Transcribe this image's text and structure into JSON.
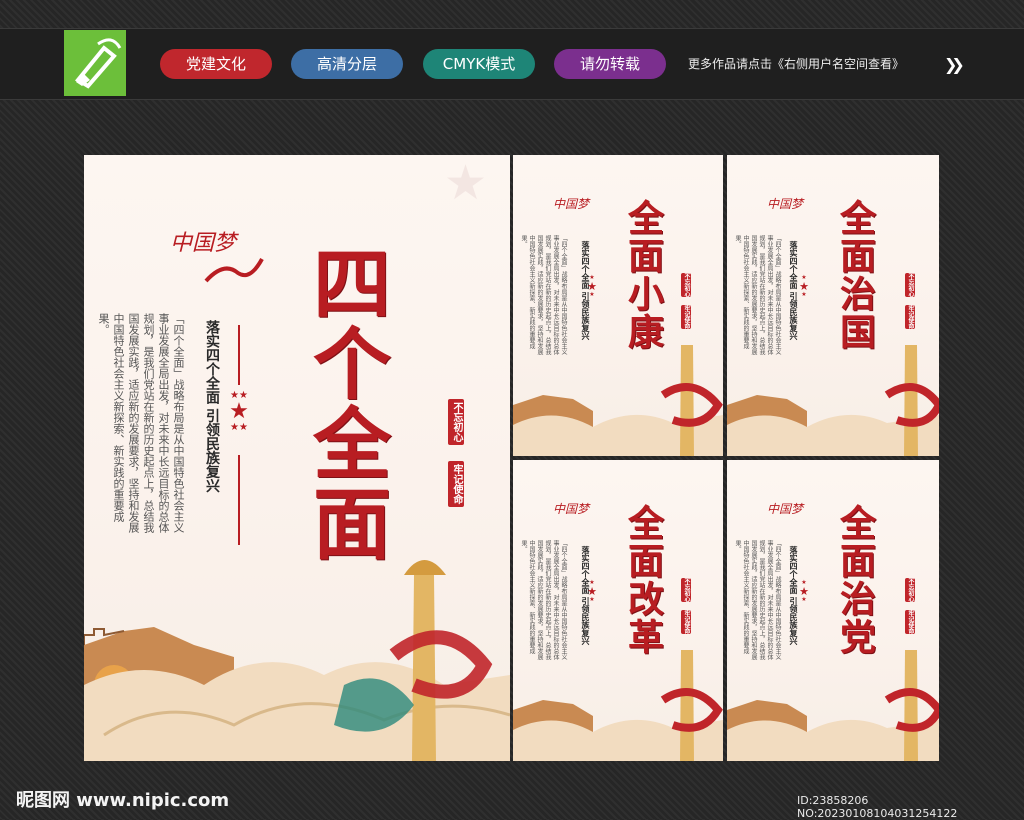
{
  "toolbar": {
    "tags": [
      {
        "label": "党建文化",
        "color": "#c0272d"
      },
      {
        "label": "高清分层",
        "color": "#3d6ea5"
      },
      {
        "label": "CMYK模式",
        "color": "#1e8577"
      },
      {
        "label": "请勿转载",
        "color": "#7b2f8e"
      }
    ],
    "note": "更多作品请点击《右侧用户名空间查看》",
    "arrow_icon": "double-chevron-right-icon"
  },
  "main_poster": {
    "title": "四个全面",
    "dream_logo": "中国梦",
    "subtitle": "落实四个全面  引领民族复兴",
    "body": "「四个全面」战略布局是从中国特色社会主义事业发展全局出发，对未来中长远目标的总体规划，是我们党站在新的历史起点上，总结我国发展实践，适应新的发展要求，坚持和发展中国特色社会主义新探索、新实践的重要成果。",
    "seal1": "不忘初心",
    "seal2": "牢记使命"
  },
  "small_posters": [
    {
      "title": "全面小康"
    },
    {
      "title": "全面治国"
    },
    {
      "title": "全面改革"
    },
    {
      "title": "全面治党"
    }
  ],
  "small_common": {
    "dream_logo": "中国梦",
    "subtitle": "落实四个全面  引领民族复兴",
    "body": "「四个全面」战略布局是从中国特色社会主义事业发展全局出发，对未来中长远目标的总体规划，是我们党站在新的历史起点上，总结我国发展实践，适应新的发展要求，坚持和发展中国特色社会主义新探索、新实践的重要成果。",
    "seal1": "不忘初心",
    "seal2": "牢记使命"
  },
  "watermark": {
    "left": "昵图网 www.nipic.com",
    "right": "ID:23858206 NO:20230108104031254122"
  },
  "colors": {
    "accent_red": "#b81d22",
    "gold": "#e3b664",
    "cloud": "#f2dcc0"
  }
}
